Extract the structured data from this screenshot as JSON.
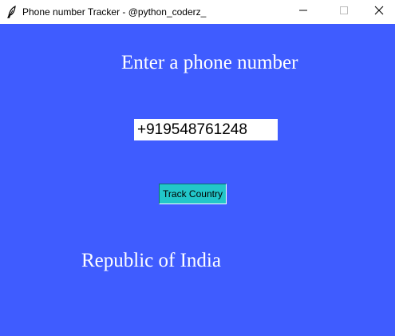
{
  "window": {
    "title": "Phone number Tracker - @python_coderz_",
    "icon": "feather-icon",
    "controls": [
      "minimize-icon",
      "maximize-icon",
      "close-icon"
    ]
  },
  "main": {
    "heading": "Enter a phone number",
    "phone_input": {
      "value": "+919548761248"
    },
    "track_button_label": "Track Country",
    "result_text": "Republic of India"
  },
  "colors": {
    "background": "#3f5cff",
    "button": "#22c6c9",
    "text": "#ffffff"
  }
}
